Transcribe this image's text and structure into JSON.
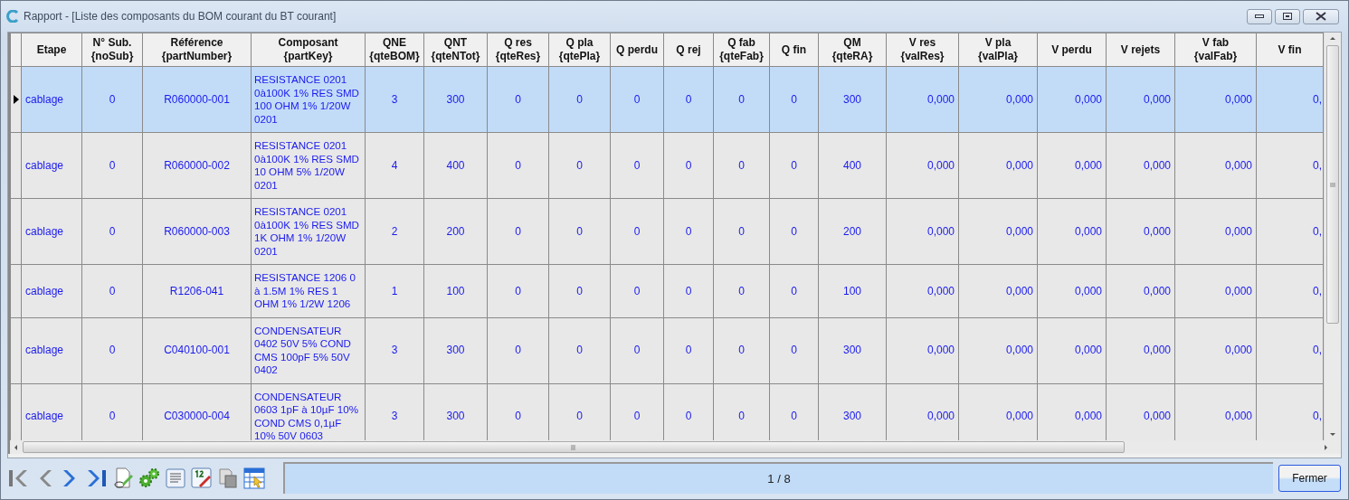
{
  "window": {
    "title": "Rapport - [Liste des composants du BOM courant du BT courant]"
  },
  "table": {
    "columns": [
      {
        "label": "Etape"
      },
      {
        "label": "N° Sub.",
        "sublabel": "{noSub}"
      },
      {
        "label": "Référence",
        "sublabel": "{partNumber}"
      },
      {
        "label": "Composant",
        "sublabel": "{partKey}"
      },
      {
        "label": "QNE",
        "sublabel": "{qteBOM}"
      },
      {
        "label": "QNT",
        "sublabel": "{qteNTot}"
      },
      {
        "label": "Q res",
        "sublabel": "{qteRes}"
      },
      {
        "label": "Q pla",
        "sublabel": "{qtePla}"
      },
      {
        "label": "Q perdu"
      },
      {
        "label": "Q rej"
      },
      {
        "label": "Q fab",
        "sublabel": "{qteFab}"
      },
      {
        "label": "Q fin"
      },
      {
        "label": "QM",
        "sublabel": "{qteRA}"
      },
      {
        "label": "V  res",
        "sublabel": "{valRes}"
      },
      {
        "label": "V pla",
        "sublabel": "{valPla}"
      },
      {
        "label": "V perdu"
      },
      {
        "label": "V rejets"
      },
      {
        "label": "V fab",
        "sublabel": "{valFab}"
      },
      {
        "label": "V fin"
      }
    ],
    "rows": [
      {
        "selected": true,
        "cells": [
          "cablage",
          "0",
          "R060000-001",
          "RESISTANCE 0201 0à100K 1% RES SMD 100 OHM 1% 1/20W 0201",
          "3",
          "300",
          "0",
          "0",
          "0",
          "0",
          "0",
          "0",
          "300",
          "0,000",
          "0,000",
          "0,000",
          "0,000",
          "0,000",
          "0,"
        ]
      },
      {
        "selected": false,
        "cells": [
          "cablage",
          "0",
          "R060000-002",
          "RESISTANCE 0201 0à100K 1% RES SMD 10 OHM 5% 1/20W 0201",
          "4",
          "400",
          "0",
          "0",
          "0",
          "0",
          "0",
          "0",
          "400",
          "0,000",
          "0,000",
          "0,000",
          "0,000",
          "0,000",
          "0,"
        ]
      },
      {
        "selected": false,
        "cells": [
          "cablage",
          "0",
          "R060000-003",
          "RESISTANCE 0201 0à100K 1% RES SMD 1K OHM 1% 1/20W 0201",
          "2",
          "200",
          "0",
          "0",
          "0",
          "0",
          "0",
          "0",
          "200",
          "0,000",
          "0,000",
          "0,000",
          "0,000",
          "0,000",
          "0,"
        ]
      },
      {
        "selected": false,
        "cells": [
          "cablage",
          "0",
          "R1206-041",
          "RESISTANCE 1206 0 à 1.5M 1% RES 1 OHM 1% 1/2W 1206",
          "1",
          "100",
          "0",
          "0",
          "0",
          "0",
          "0",
          "0",
          "100",
          "0,000",
          "0,000",
          "0,000",
          "0,000",
          "0,000",
          "0,"
        ]
      },
      {
        "selected": false,
        "cells": [
          "cablage",
          "0",
          "C040100-001",
          "CONDENSATEUR 0402 50V 5% COND CMS 100pF 5% 50V 0402",
          "3",
          "300",
          "0",
          "0",
          "0",
          "0",
          "0",
          "0",
          "300",
          "0,000",
          "0,000",
          "0,000",
          "0,000",
          "0,000",
          "0,"
        ]
      },
      {
        "selected": false,
        "cells": [
          "cablage",
          "0",
          "C030000-004",
          "CONDENSATEUR 0603 1pF à 10µF 10% COND CMS 0,1µF 10% 50V 0603",
          "3",
          "300",
          "0",
          "0",
          "0",
          "0",
          "0",
          "0",
          "300",
          "0,000",
          "0,000",
          "0,000",
          "0,000",
          "0,000",
          "0,"
        ]
      }
    ]
  },
  "toolbar": [
    {
      "kind": "first"
    },
    {
      "kind": "prev"
    },
    {
      "kind": "next"
    },
    {
      "kind": "last"
    },
    {
      "kind": "docedit"
    },
    {
      "kind": "gears"
    },
    {
      "kind": "list"
    },
    {
      "kind": "numedit"
    },
    {
      "kind": "copy"
    },
    {
      "kind": "tablecursor"
    }
  ],
  "status": {
    "text": "1 / 8"
  },
  "buttons": [
    {
      "label": "Fermer"
    }
  ]
}
